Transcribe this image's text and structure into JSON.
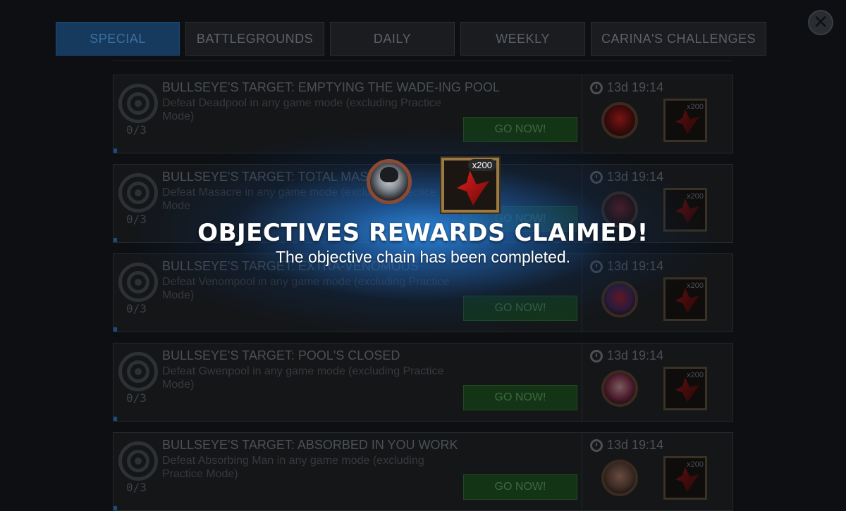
{
  "tabs": [
    {
      "label": "SPECIAL",
      "active": true
    },
    {
      "label": "BATTLEGROUNDS",
      "active": false
    },
    {
      "label": "DAILY",
      "active": false
    },
    {
      "label": "WEEKLY",
      "active": false
    },
    {
      "label": "CARINA'S CHALLENGES",
      "active": false
    }
  ],
  "close_icon": "close-x-icon",
  "objectives": [
    {
      "title": "BULLSEYE'S TARGET: EMPTYING THE WADE-ING POOL",
      "description": "Defeat Deadpool in any game mode (excluding Practice Mode)",
      "progress": "0/3",
      "button": "GO NOW!",
      "timer": "13d 19:14",
      "reward_qty": "x200"
    },
    {
      "title": "BULLSEYE'S TARGET: TOTAL MASACRE",
      "description": "Defeat Masacre in any game mode (excluding Practice Mode",
      "progress": "0/3",
      "button": "GO NOW!",
      "timer": "13d 19:14",
      "reward_qty": "x200"
    },
    {
      "title": "BULLSEYE'S TARGET: EXTRA-VENOMOUS",
      "description": "Defeat Venompool in any game mode (excluding Practice Mode)",
      "progress": "0/3",
      "button": "GO NOW!",
      "timer": "13d 19:14",
      "reward_qty": "x200"
    },
    {
      "title": "BULLSEYE'S TARGET: POOL'S CLOSED",
      "description": "Defeat Gwenpool in any game mode (excluding Practice Mode)",
      "progress": "0/3",
      "button": "GO NOW!",
      "timer": "13d 19:14",
      "reward_qty": "x200"
    },
    {
      "title": "BULLSEYE'S TARGET: ABSORBED IN YOU WORK",
      "description": "Defeat Absorbing Man in any game mode (excluding Practice Mode)",
      "progress": "0/3",
      "button": "GO NOW!",
      "timer": "13d 19:14",
      "reward_qty": "x200"
    }
  ],
  "popup": {
    "title": "OBJECTIVES REWARDS CLAIMED!",
    "subtitle": "The objective chain has been completed.",
    "reward_qty": "x200"
  },
  "colors": {
    "accent": "#1c4c7f",
    "popup_glow": "#2e8ce6",
    "go_button": "#143416"
  }
}
